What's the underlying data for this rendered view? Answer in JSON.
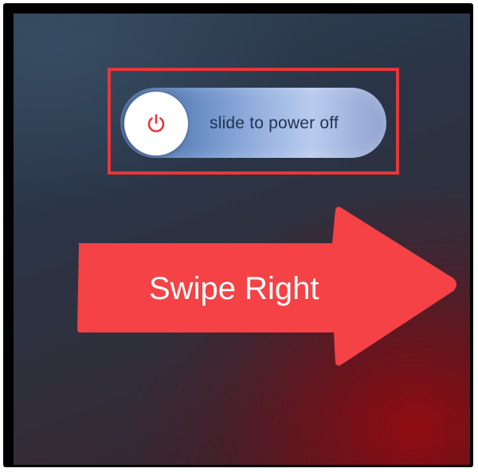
{
  "power_slider": {
    "label": "slide to power off",
    "knob_icon": "power-icon",
    "accent_color": "#e5383b"
  },
  "annotation": {
    "arrow_label": "Swipe Right",
    "arrow_color": "#f44246",
    "highlight_color": "#e5383b"
  }
}
